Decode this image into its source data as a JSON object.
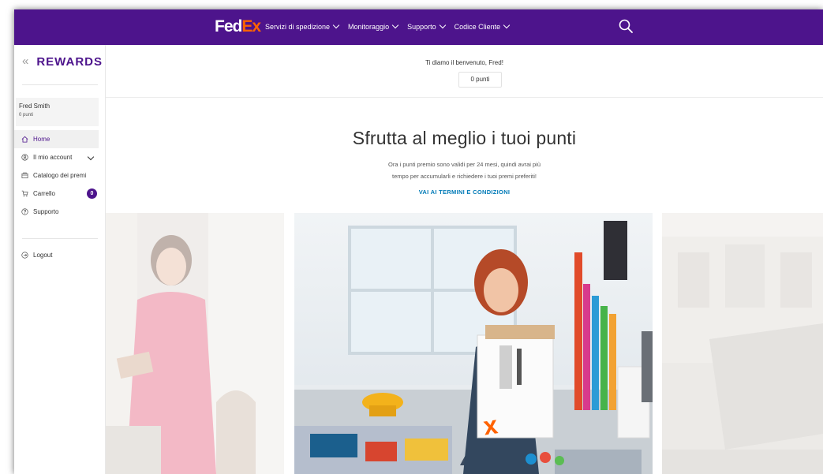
{
  "header": {
    "logo_fed": "Fed",
    "logo_ex": "Ex",
    "nav": [
      {
        "label": "Servizi di spedizione"
      },
      {
        "label": "Monitoraggio"
      },
      {
        "label": "Supporto"
      },
      {
        "label": "Codice Cliente"
      }
    ]
  },
  "sidebar": {
    "title": "REWARDS",
    "collapse_glyph": "«",
    "user": {
      "name": "Fred Smith",
      "points": "0 punti"
    },
    "items": [
      {
        "label": "Home",
        "icon": "home-icon"
      },
      {
        "label": "Il mio account",
        "icon": "account-icon"
      },
      {
        "label": "Catalogo dei premi",
        "icon": "catalog-icon"
      },
      {
        "label": "Carrello",
        "icon": "cart-icon",
        "badge": "0"
      },
      {
        "label": "Supporto",
        "icon": "support-icon"
      }
    ],
    "logout": {
      "label": "Logout",
      "icon": "logout-icon"
    }
  },
  "welcome": {
    "greeting": "Ti diamo il benvenuto, Fred!",
    "points_button": "0 punti"
  },
  "hero": {
    "title": "Sfrutta al meglio i tuoi punti",
    "line1": "Ora i punti premio sono validi per 24 mesi, quindi avrai più",
    "line2": "tempo per accumularli e richiedere i tuoi premi preferiti!",
    "terms_link": "VAI AI TERMINI E CONDIZIONI"
  },
  "colors": {
    "brand_purple": "#4d148c",
    "brand_orange": "#ff6200",
    "link_blue": "#007ab7"
  }
}
